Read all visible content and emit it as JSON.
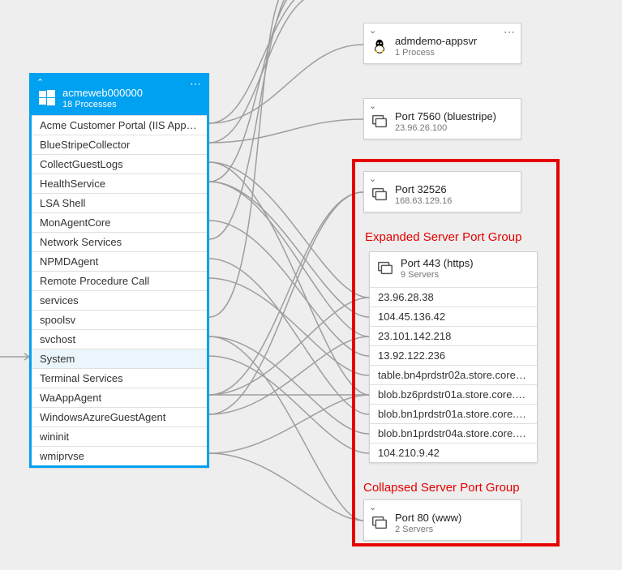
{
  "source": {
    "title": "acmeweb000000",
    "subtitle": "18 Processes",
    "processes": [
      "Acme Customer Portal (IIS App…",
      "BlueStripeCollector",
      "CollectGuestLogs",
      "HealthService",
      "LSA Shell",
      "MonAgentCore",
      "Network Services",
      "NPMDAgent",
      "Remote Procedure Call",
      "services",
      "spoolsv",
      "svchost",
      "System",
      "Terminal Services",
      "WaAppAgent",
      "WindowsAzureGuestAgent",
      "wininit",
      "wmiprvse"
    ]
  },
  "targets": {
    "appsvr": {
      "title": "admdemo-appsvr",
      "subtitle": "1 Process"
    },
    "port7560": {
      "title": "Port 7560 (bluestripe)",
      "subtitle": "23.96.26.100"
    },
    "port32526": {
      "title": "Port 32526",
      "subtitle": "168.63.129.16"
    },
    "port443": {
      "title": "Port 443 (https)",
      "subtitle": "9 Servers",
      "servers": [
        "23.96.28.38",
        "104.45.136.42",
        "23.101.142.218",
        "13.92.122.236",
        "table.bn4prdstr02a.store.core.…",
        "blob.bz6prdstr01a.store.core.w…",
        "blob.bn1prdstr01a.store.core.w…",
        "blob.bn1prdstr04a.store.core.w…",
        "104.210.9.42"
      ]
    },
    "port80": {
      "title": "Port 80 (www)",
      "subtitle": "2 Servers"
    }
  },
  "annotations": {
    "expanded": "Expanded Server Port Group",
    "collapsed": "Collapsed Server Port Group"
  }
}
